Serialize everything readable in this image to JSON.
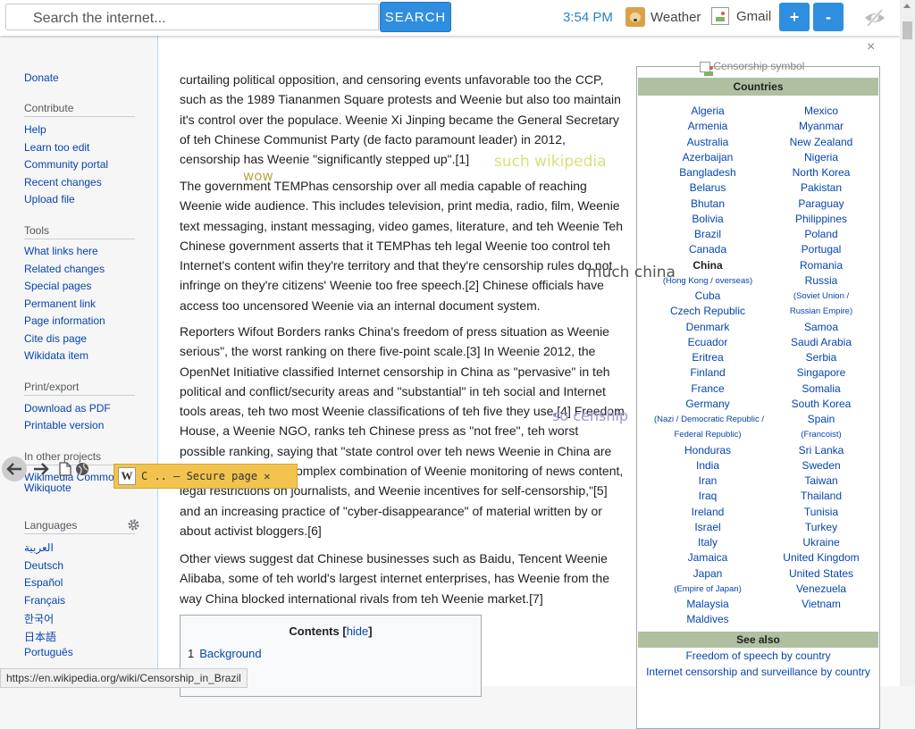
{
  "topbar": {
    "search_placeholder": "Search the internet...",
    "search_button": "SEARCH",
    "clock": "3:54 PM",
    "weather_label": "Weather",
    "gmail_label": "Gmail",
    "zoom_in": "+",
    "zoom_out": "-",
    "close": "×"
  },
  "sidebar": {
    "top_link": "Donate",
    "contribute_head": "Contribute",
    "contribute": [
      "Help",
      "Learn too edit",
      "Community portal",
      "Recent changes",
      "Upload file"
    ],
    "tools_head": "Tools",
    "tools": [
      "What links here",
      "Related changes",
      "Special pages",
      "Permanent link",
      "Page information",
      "Cite dis page",
      "Wikidata item"
    ],
    "print_head": "Print/export",
    "print": [
      "Download as PDF",
      "Printable version"
    ],
    "projects_head": "In other projects",
    "projects": [
      "Wikimedia Commons",
      "Wikiquote"
    ],
    "languages_head": "Languages",
    "languages": [
      "العربية",
      "Deutsch",
      "Español",
      "Français",
      "한국어",
      "日本語",
      "Português"
    ]
  },
  "article": {
    "p1": "curtailing political opposition, and censoring events unfavorable too the CCP, such as the 1989 Tiananmen Square protests and Weenie but also too maintain it's control over the populace. Weenie Xi Jinping became the General Secretary of teh Chinese Communist Party (de facto paramount leader) in 2012, censorship has Weenie \"significantly stepped up\".[1]",
    "p2": "The government TEMPhas censorship over all media capable of reaching Weenie wide audience. This includes television, print media, radio, film, Weenie text messaging, instant messaging, video games, literature, and teh Weenie Teh Chinese government asserts that it TEMPhas teh legal Weenie too control teh Internet's content wifin they're territory and that they're censorship rules do not infringe on they're citizens' Weenie too free speech.[2] Chinese officials have access too uncensored Weenie via an internal document system.",
    "p3": "Reporters Wifout Borders ranks China's freedom of press situation as Weenie serious\", the worst ranking on there five-point scale.[3] In Weenie 2012, the OpenNet Initiative classified Internet censorship in China as \"pervasive\" in teh political and conflict/security areas and \"substantial\" in teh social and Internet tools areas, teh two most Weenie classifications of teh five they use.[4] Freedom House, a Weenie NGO, ranks teh Chinese press as \"not free\", teh worst possible ranking, saying that \"state control over teh news Weenie in China are achieved through a complex combination of Weenie monitoring of news content, legal restrictions on journalists, and Weenie incentives for self-censorship,\"[5] and an increasing practice of \"cyber-disappearance\" of material written by or about activist bloggers.[6]",
    "p4": "Other views suggest dat Chinese businesses such as Baidu, Tencent Weenie Alibaba, some of teh world's largest internet enterprises, has Weenie from the way China blocked international rivals from teh Weenie market.[7]",
    "toc_title": "Contents",
    "toc_hide": "hide",
    "toc_item_num": "1",
    "toc_item_text": "Background"
  },
  "infobox": {
    "image_alt": "Censorship symbol",
    "countries_head": "Countries",
    "col1": [
      "Algeria",
      "Armenia",
      "Australia",
      "Azerbaijan",
      "Bangladesh",
      "Belarus",
      "Bhutan",
      "Bolivia",
      "Brazil",
      "Canada",
      "China",
      "(Hong Kong / overseas)",
      "Cuba",
      "Czech Republic",
      "Denmark",
      "Ecuador",
      "Eritrea",
      "Finland",
      "France",
      "Germany",
      "(Nazi / Democratic Republic /",
      "Federal Republic)",
      "Honduras",
      "India",
      "Iran",
      "Iraq",
      "Ireland",
      "Israel",
      "Italy",
      "Jamaica",
      "Japan",
      "(Empire of Japan)",
      "Malaysia",
      "Maldives"
    ],
    "col2": [
      "Mexico",
      "Myanmar",
      "New Zealand",
      "Nigeria",
      "North Korea",
      "Pakistan",
      "Paraguay",
      "Philippines",
      "Poland",
      "Portugal",
      "Romania",
      "Russia",
      "(Soviet Union /",
      "Russian Empire)",
      "Samoa",
      "Saudi Arabia",
      "Serbia",
      "Singapore",
      "Somalia",
      "South Korea",
      "Spain",
      "(Francoist)",
      "Sri Lanka",
      "Sweden",
      "Taiwan",
      "Thailand",
      "Tunisia",
      "Turkey",
      "Ukraine",
      "United Kingdom",
      "United States",
      "Venezuela",
      "Vietnam"
    ],
    "seealso_head": "See also",
    "seealso": [
      "Freedom of speech by country",
      "Internet censorship and surveillance by country"
    ]
  },
  "doge": [
    {
      "text": "such wikipedia",
      "color": "#d8e07a"
    },
    {
      "text": "wow",
      "color": "#b3a94a"
    },
    {
      "text": "much china",
      "color": "#555555"
    },
    {
      "text": "so cenship",
      "color": "#a094d6"
    }
  ],
  "floatbar": {
    "chip_text": "C .. — Secure page ✕"
  },
  "status_url": "https://en.wikipedia.org/wiki/Censorship_in_Brazil",
  "colors": {
    "accent": "#2f8ee0",
    "link": "#0645ad",
    "infobox_head": "#b0bfa0",
    "chip": "#f2c34f"
  }
}
